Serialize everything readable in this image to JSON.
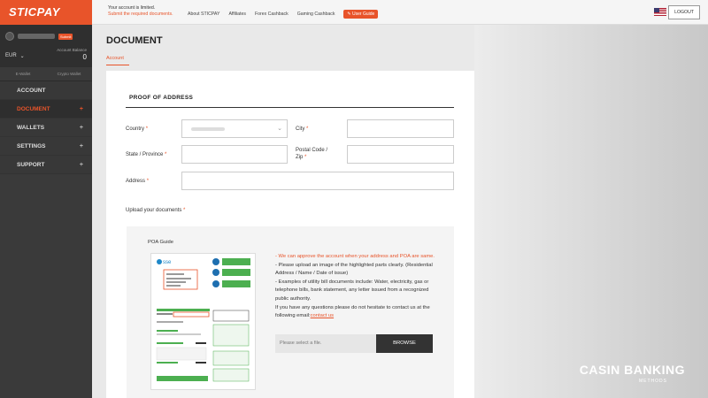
{
  "brand": {
    "name": "STICPAY",
    "accent": "#e8542a"
  },
  "sidebar": {
    "submit_badge": "Submit",
    "balance_label": "Account Balance",
    "currency": "EUR",
    "balance": "0",
    "wallet_tabs": [
      "E-Wallet",
      "Crypto Wallet"
    ],
    "items": [
      {
        "label": "ACCOUNT"
      },
      {
        "label": "DOCUMENT",
        "plus": "+"
      },
      {
        "label": "WALLETS",
        "plus": "+"
      },
      {
        "label": "SETTINGS",
        "plus": "+"
      },
      {
        "label": "SUPPORT",
        "plus": "+"
      }
    ]
  },
  "topbar": {
    "notice_line1": "Your account is limited.",
    "notice_line2": "Submit the required documents.",
    "nav": [
      "About STICPAY",
      "Affiliates",
      "Forex Cashback",
      "Gaming Cashback"
    ],
    "guide_label": "User Guide",
    "logout_label": "LOGOUT"
  },
  "page": {
    "title": "DOCUMENT",
    "breadcrumb": "Account"
  },
  "form": {
    "section_title": "PROOF OF ADDRESS",
    "country_label": "Country",
    "city_label": "City",
    "state_label": "State / Province",
    "postal_label_1": "Postal Code /",
    "postal_label_2": "Zip",
    "address_label": "Address",
    "upload_label": "Upload your documents",
    "req_mark": "*"
  },
  "poa": {
    "title": "POA Guide",
    "instr_orange": "- We can approve the account when your address and POA are same.",
    "instr_1": "- Please upload an image of the highlighted parts clearly. (Residential Address / Name / Date of issue)",
    "instr_2": "- Examples of utility bill documents include: Water, electricity, gas or telephone bills, bank statement, any letter issued from a recognized public authority.",
    "instr_3": "If you have any questions please do not hesitate to contact us at the following email:",
    "contact_link": "contact us",
    "file_placeholder": "Please select a file.",
    "browse_label": "BROWSE"
  },
  "bill": {
    "brand": "sse"
  },
  "watermark": {
    "main": "CASIN  BANKING",
    "sub": "METHODS"
  }
}
